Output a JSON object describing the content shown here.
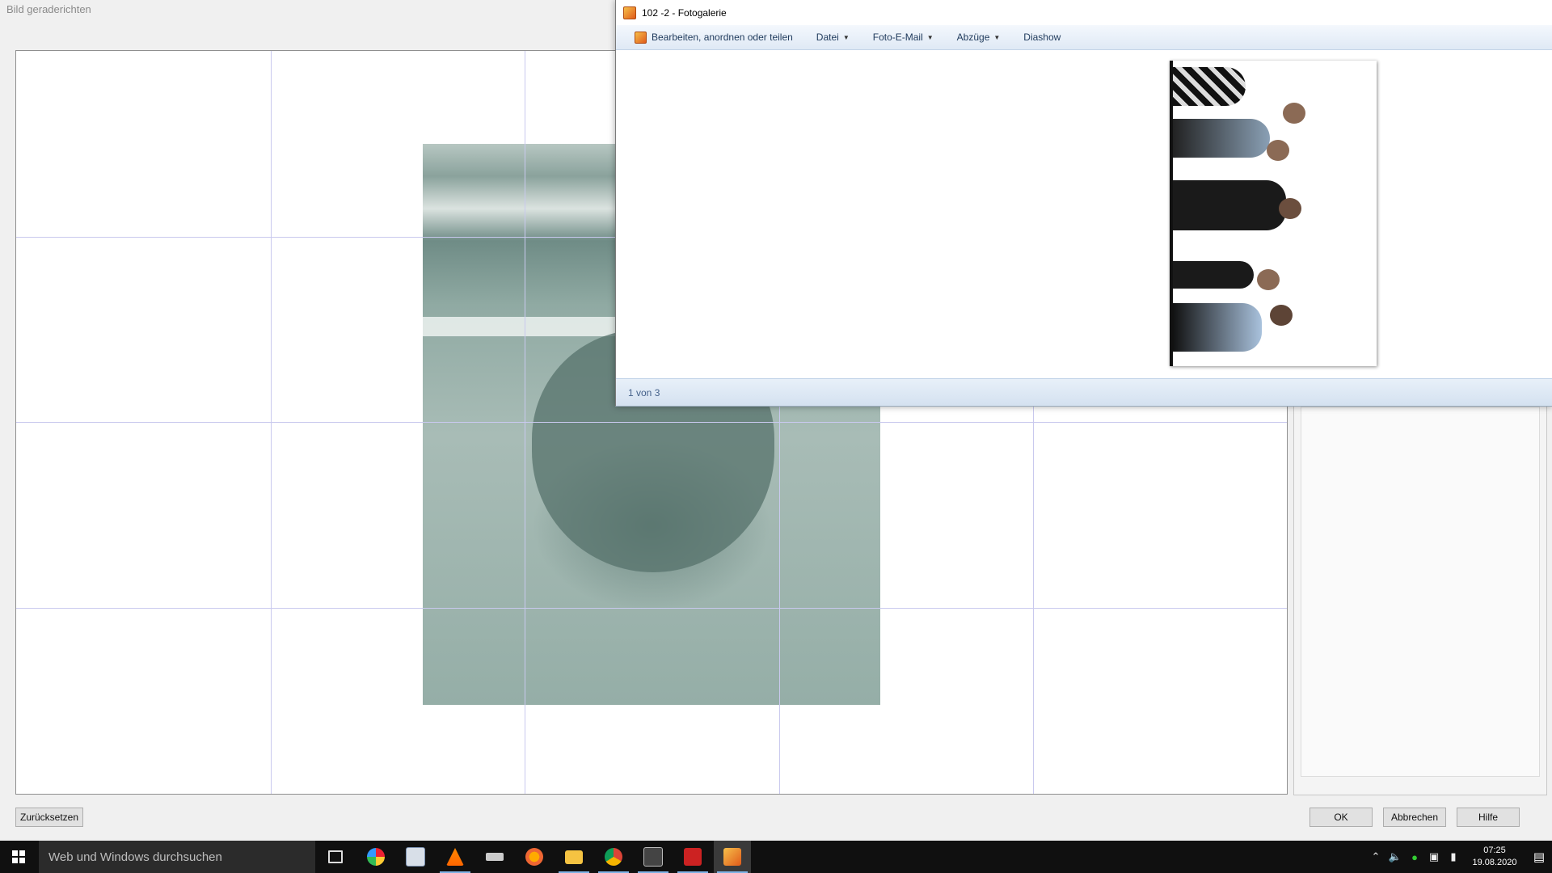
{
  "straighten_dialog": {
    "title": "Bild geraderichten",
    "reset_button": "Zurücksetzen",
    "ok_button": "OK",
    "cancel_button": "Abbrechen",
    "help_button": "Hilfe"
  },
  "gallery": {
    "title": "102 -2 - Fotogalerie",
    "menu": {
      "edit": "Bearbeiten, anordnen oder teilen",
      "file": "Datei",
      "email": "Foto-E-Mail",
      "prints": "Abzüge",
      "slideshow": "Diashow"
    },
    "status": "1 von 3"
  },
  "taskbar": {
    "search_placeholder": "Web und Windows durchsuchen",
    "clock_time": "07:25",
    "clock_date": "19.08.2020",
    "apps": [
      "task-view-icon",
      "picasa-icon",
      "pdf-viewer-icon",
      "vlc-icon",
      "scanner-icon",
      "avast-icon",
      "file-explorer-icon",
      "chrome-icon",
      "camera-app-icon",
      "photo-app-icon",
      "photo-gallery-icon"
    ]
  }
}
